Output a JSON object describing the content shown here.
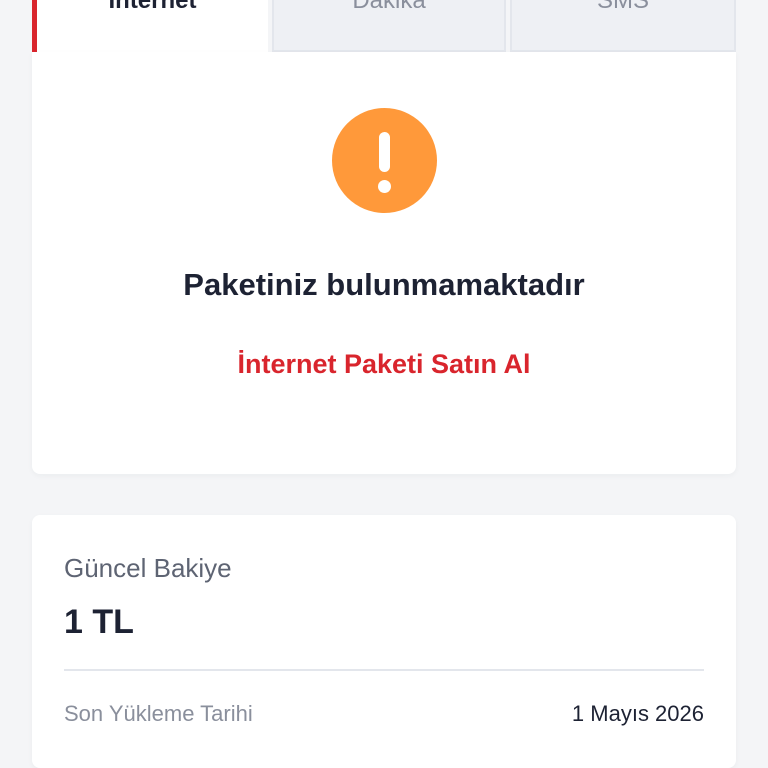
{
  "tabs": [
    {
      "label": "İnternet",
      "active": true
    },
    {
      "label": "Dakika",
      "active": false
    },
    {
      "label": "SMS",
      "active": false
    }
  ],
  "package_card": {
    "icon": "alert-exclamation-icon",
    "title": "Paketiniz bulunmamaktadır",
    "buy_link": "İnternet Paketi Satın Al"
  },
  "balance_card": {
    "label": "Güncel Bakiye",
    "value": "1 TL",
    "last_topup_label": "Son Yükleme Tarihi",
    "last_topup_date": "1 Mayıs 2026"
  },
  "colors": {
    "accent_red": "#d9252d",
    "warning_orange": "#ff993a",
    "text_dark": "#1d2233",
    "background": "#f4f5f7"
  }
}
